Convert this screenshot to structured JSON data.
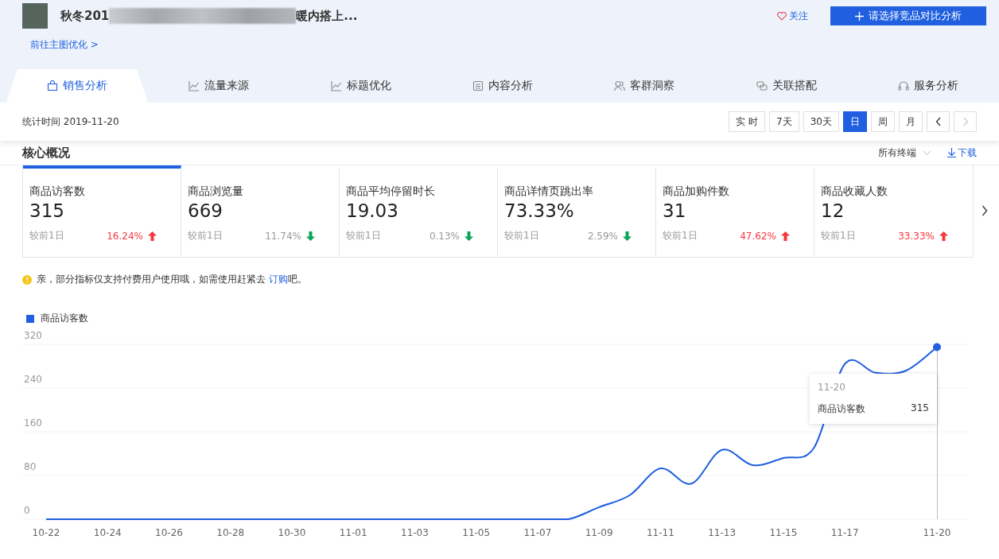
{
  "product": {
    "title_start": "秋冬201",
    "title_end": "暖内搭上...",
    "link": "前往主图优化 >",
    "follow": "关注",
    "compare_button": "请选择竞品对比分析"
  },
  "tabs": [
    {
      "label": "销售分析",
      "selected": true
    },
    {
      "label": "流量来源",
      "selected": false
    },
    {
      "label": "标题优化",
      "selected": false
    },
    {
      "label": "内容分析",
      "selected": false
    },
    {
      "label": "客群洞察",
      "selected": false
    },
    {
      "label": "关联搭配",
      "selected": false
    },
    {
      "label": "服务分析",
      "selected": false
    }
  ],
  "stat_time": "统计时间 2019-11-20",
  "periods": [
    {
      "label": "实 时",
      "selected": false
    },
    {
      "label": "7天",
      "selected": false
    },
    {
      "label": "30天",
      "selected": false
    },
    {
      "label": "日",
      "selected": true
    },
    {
      "label": "周",
      "selected": false
    },
    {
      "label": "月",
      "selected": false
    }
  ],
  "pager": {
    "prev_disabled": false,
    "next_disabled": true
  },
  "section": {
    "title": "核心概况",
    "terminal": "所有终端",
    "download": "下载"
  },
  "metrics": [
    {
      "label": "商品访客数",
      "value": "315",
      "compare": "较前1日",
      "change": "16.24%",
      "increase": true,
      "selected": true
    },
    {
      "label": "商品浏览量",
      "value": "669",
      "compare": "较前1日",
      "change": "11.74%",
      "increase": false,
      "selected": false
    },
    {
      "label": "商品平均停留时长",
      "value": "19.03",
      "compare": "较前1日",
      "change": "0.13%",
      "increase": false,
      "selected": false
    },
    {
      "label": "商品详情页跳出率",
      "value": "73.33%",
      "compare": "较前1日",
      "change": "2.59%",
      "increase": false,
      "selected": false
    },
    {
      "label": "商品加购件数",
      "value": "31",
      "compare": "较前1日",
      "change": "47.62%",
      "increase": true,
      "selected": false
    },
    {
      "label": "商品收藏人数",
      "value": "12",
      "compare": "较前1日",
      "change": "33.33%",
      "increase": true,
      "selected": false
    }
  ],
  "notice": {
    "text": "亲，部分指标仅支持付费用户使用哦，如需使用赶紧去 ",
    "link": "订购",
    "tail": "吧。"
  },
  "chart": {
    "chart_data": {
      "type": "line",
      "categories": [
        "10-22",
        null,
        "10-24",
        null,
        "10-26",
        null,
        "10-28",
        null,
        "10-30",
        null,
        "11-01",
        null,
        "11-03",
        null,
        "11-05",
        null,
        "11-07",
        null,
        "11-09",
        null,
        "11-11",
        null,
        "11-13",
        null,
        "11-15",
        null,
        "11-17",
        null,
        null,
        "11-20"
      ],
      "series": [
        {
          "name": "商品访客数",
          "color": "#1f5fe0",
          "values": [
            0,
            0,
            0,
            0,
            0,
            0,
            0,
            0,
            0,
            0,
            0,
            0,
            0,
            0,
            0,
            0,
            0,
            0,
            22,
            44,
            93,
            65,
            127,
            99,
            112,
            131,
            284,
            268,
            272,
            315
          ]
        }
      ],
      "ylim": [
        0,
        320
      ],
      "yticks": [
        0,
        80,
        160,
        240,
        320
      ],
      "grid": true
    },
    "tooltip": {
      "date": "11-20",
      "name": "商品访客数",
      "value": "315"
    }
  }
}
